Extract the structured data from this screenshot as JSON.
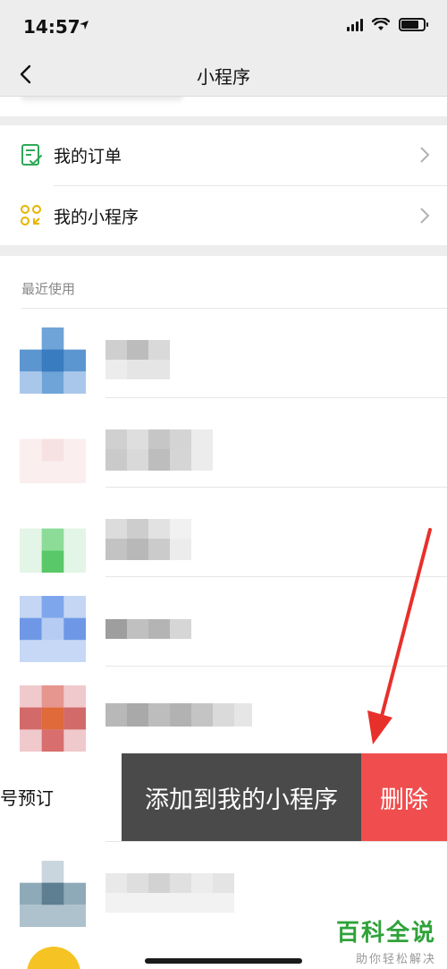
{
  "status_bar": {
    "time": "14:57"
  },
  "nav": {
    "title": "小程序"
  },
  "menu": {
    "orders_label": "我的订单",
    "my_mini_programs_label": "我的小程序"
  },
  "recent": {
    "section_title": "最近使用"
  },
  "swipe_actions": {
    "add_label": "添加到我的小程序",
    "delete_label": "删除",
    "partial_row_text": "号预订"
  },
  "watermark": {
    "title": "百科全说",
    "subtitle": "助你轻松解决"
  },
  "colors": {
    "nav_background": "#ededed",
    "add_button": "#4a4a4a",
    "delete_button": "#f04e4e",
    "arrow": "#e8302b",
    "watermark_green": "#2fa23a"
  },
  "icons": {
    "back": "chevron-left-icon",
    "orders": "order-list-icon",
    "mini_programs": "mini-program-grid-icon",
    "chevron": "chevron-right-icon"
  }
}
